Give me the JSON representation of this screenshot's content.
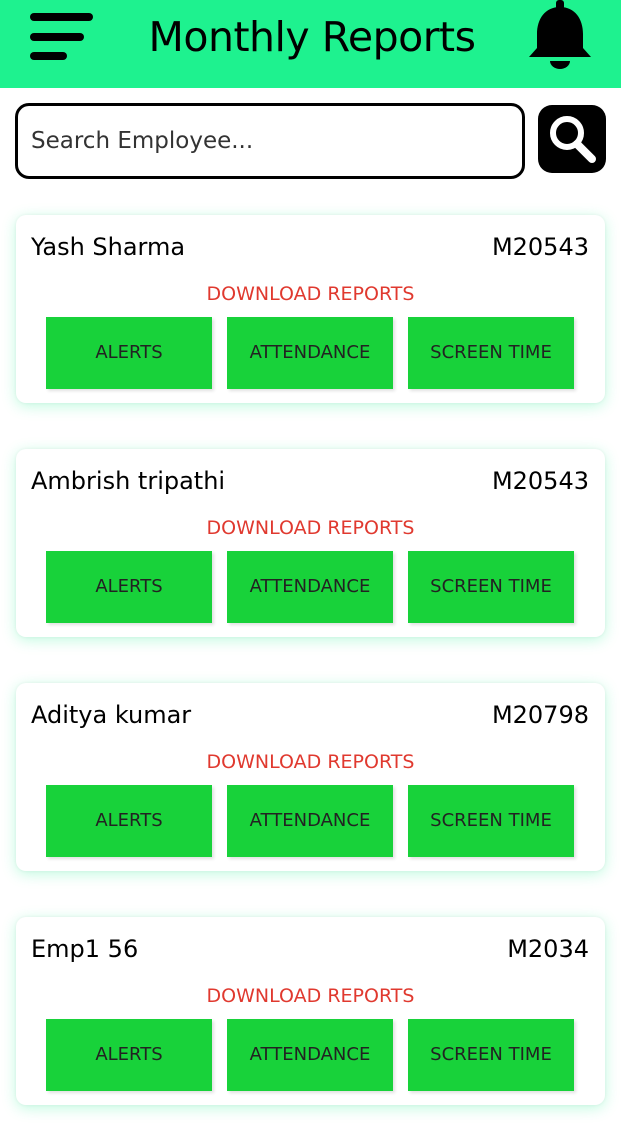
{
  "header": {
    "title": "Monthly Reports",
    "menu_icon": "hamburger-menu-icon",
    "bell_icon": "notification-bell-icon",
    "background_color": "#1ef28f"
  },
  "search": {
    "placeholder": "Search Employee...",
    "value": "",
    "button_icon": "search-icon"
  },
  "employees": [
    {
      "name": "Yash Sharma",
      "id": "M20543",
      "download_label": "DOWNLOAD REPORTS",
      "buttons": {
        "alerts": "ALERTS",
        "attendance": "ATTENDANCE",
        "screen_time": "SCREEN TIME"
      }
    },
    {
      "name": "Ambrish tripathi",
      "id": "M20543",
      "download_label": "DOWNLOAD REPORTS",
      "buttons": {
        "alerts": "ALERTS",
        "attendance": "ATTENDANCE",
        "screen_time": "SCREEN TIME"
      }
    },
    {
      "name": "Aditya kumar",
      "id": "M20798",
      "download_label": "DOWNLOAD REPORTS",
      "buttons": {
        "alerts": "ALERTS",
        "attendance": "ATTENDANCE",
        "screen_time": "SCREEN TIME"
      }
    },
    {
      "name": "Emp1 56",
      "id": "M2034",
      "download_label": "DOWNLOAD REPORTS",
      "buttons": {
        "alerts": "ALERTS",
        "attendance": "ATTENDANCE",
        "screen_time": "SCREEN TIME"
      }
    }
  ],
  "colors": {
    "accent": "#1ef28f",
    "button_green": "#18d23a",
    "download_red": "#e0392f"
  }
}
